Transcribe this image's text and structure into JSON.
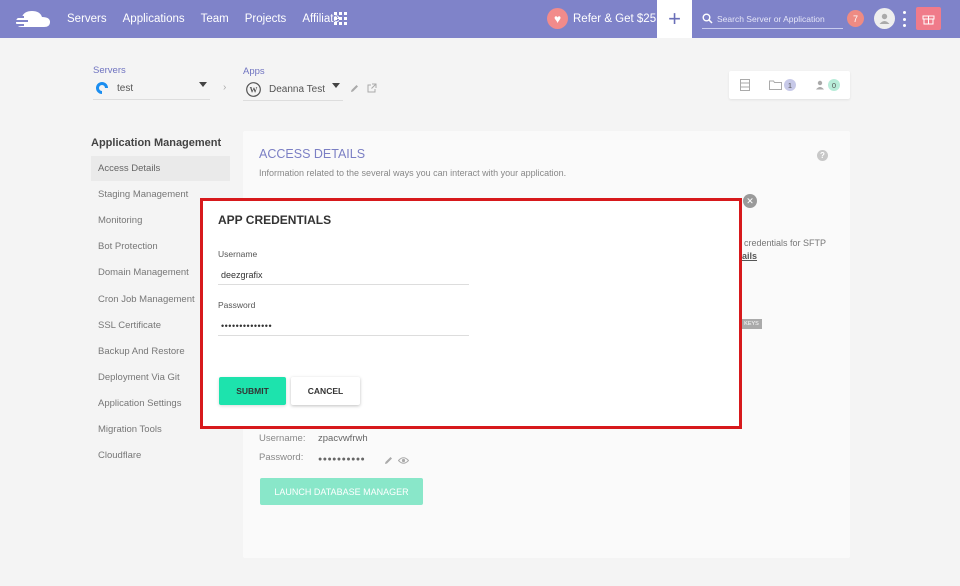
{
  "nav": {
    "links": [
      "Servers",
      "Applications",
      "Team",
      "Projects",
      "Affiliate"
    ],
    "refer_label": "Refer & Get $25",
    "search_placeholder": "Search Server or Application",
    "notification_count": "7"
  },
  "breadcrumb": {
    "servers_label": "Servers",
    "server_value": "test",
    "apps_label": "Apps",
    "app_value": "Deanna Test"
  },
  "toolbar": {
    "folder_count": "1",
    "users_count": "0"
  },
  "sidebar": {
    "title": "Application Management",
    "items": [
      "Access Details",
      "Staging Management",
      "Monitoring",
      "Bot Protection",
      "Domain Management",
      "Cron Job Management",
      "SSL Certificate",
      "Backup And Restore",
      "Deployment Via Git",
      "Application Settings",
      "Migration Tools",
      "Cloudflare"
    ]
  },
  "card": {
    "title": "ACCESS DETAILS",
    "subtitle": "Information related to the several ways you can interact with your application.",
    "partial_text": "credentials for SFTP",
    "partial_link": "ails",
    "keys_tag": "KEYS",
    "db_username_label": "Username:",
    "db_username_value": "zpacvwfrwh",
    "db_password_label": "Password:",
    "db_password_value": "●●●●●●●●●●",
    "launch_button": "LAUNCH DATABASE MANAGER"
  },
  "modal": {
    "title": "APP CREDENTIALS",
    "username_label": "Username",
    "username_value": "deezgrafix",
    "password_label": "Password",
    "password_value": "••••••••••••••",
    "submit_label": "SUBMIT",
    "cancel_label": "CANCEL"
  },
  "colors": {
    "nav_bg": "#7f83c9",
    "accent_green": "#1de3ad",
    "modal_border": "#d7191c"
  }
}
